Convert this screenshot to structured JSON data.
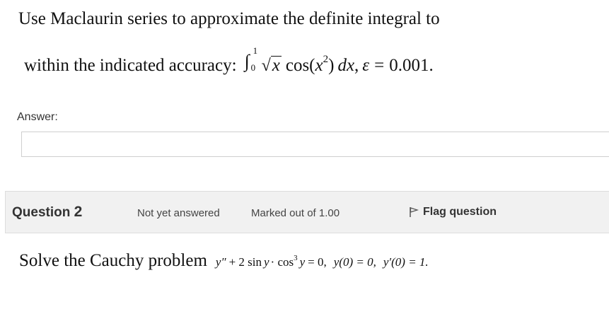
{
  "question1": {
    "line1": "Use Maclaurin series to approximate the definite integral to",
    "line2_prefix": "within the indicated accuracy:",
    "math": {
      "integral_sign": "∫",
      "upper_limit": "1",
      "lower_limit": "0",
      "sqrt_symbol": "√",
      "sqrt_arg": "x",
      "function": "cos",
      "arg_open": "(",
      "arg_var": "x",
      "arg_power": "2",
      "arg_close": ")",
      "dx": "dx",
      "separator": ",",
      "epsilon": "ε",
      "equals": "=",
      "value": "0.001."
    },
    "answer_label": "Answer:",
    "answer_value": ""
  },
  "question2": {
    "label": "Question",
    "number": "2",
    "status": "Not yet answered",
    "marks": "Marked out of 1.00",
    "flag_label": "Flag question",
    "text_prefix": "Solve the Cauchy problem",
    "equation": {
      "part1": "y″",
      "part2": "+ 2 sin",
      "part3": "y",
      "part4": "· cos",
      "power": "3",
      "part5": "y",
      "part6": "= 0,",
      "ic1": "y(0) = 0,",
      "ic2": "y′(0) = 1."
    }
  }
}
